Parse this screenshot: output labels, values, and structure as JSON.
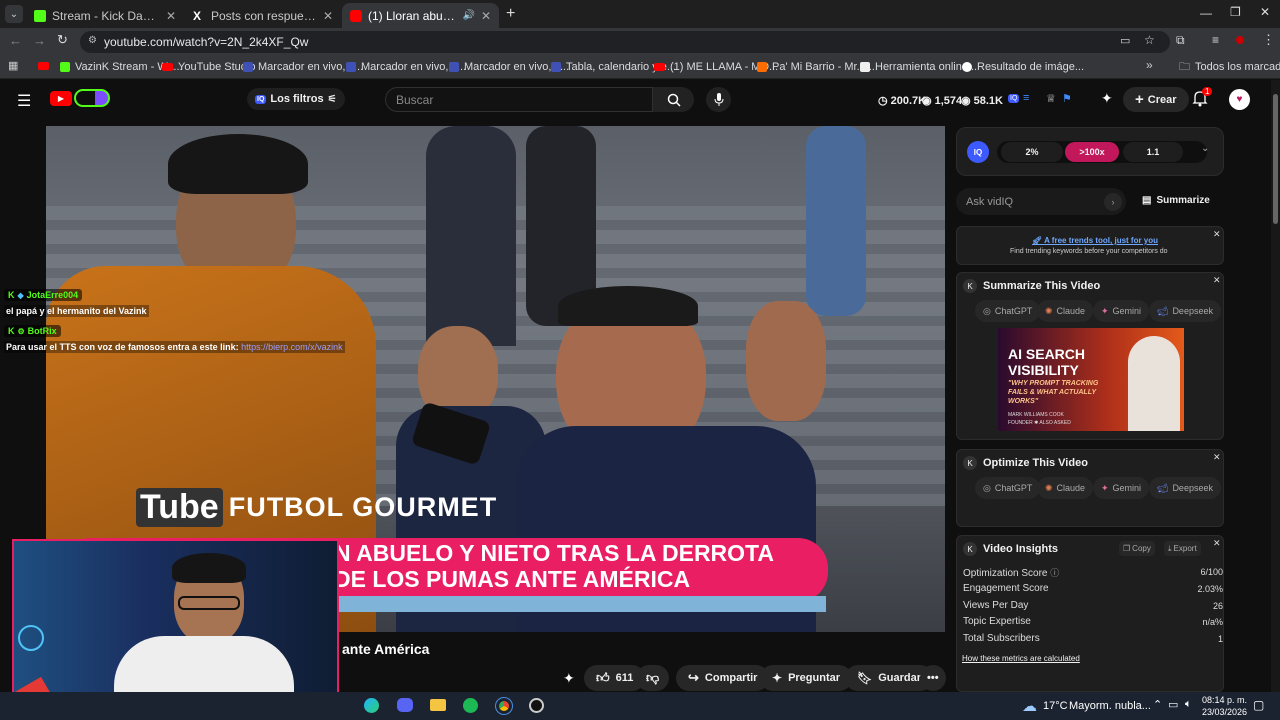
{
  "browser": {
    "tabs": [
      {
        "title": "Stream - Kick Dashboard"
      },
      {
        "title": "Posts con respuestas de VazinK"
      },
      {
        "title": "(1) Lloran abuelo y nieto tras"
      }
    ],
    "url": "youtube.com/watch?v=2N_2k4XF_Qw",
    "bookmarks": [
      "VazinK Stream - Wa...",
      "YouTube Studio",
      "Marcador en vivo, c...",
      "Marcador en vivo, c...",
      "Marcador en vivo, c...",
      "Tabla, calendario y e...",
      "(1) ME LLAMA - MO...",
      "Pa' Mi Barrio - Mr. L...",
      "Herramienta online...",
      "Resultado de imáge..."
    ],
    "all_bookmarks": "Todos los marcadores"
  },
  "youtube": {
    "filters_label": "Los filtros",
    "search_placeholder": "Buscar",
    "stats": {
      "views": "200.7K",
      "watching": "1,574",
      "subs": "58.1K"
    },
    "create_label": "Crear",
    "notif_count": "1",
    "video_title": "ante América",
    "likes": "611",
    "share_label": "Compartir",
    "ask_label": "Preguntar",
    "save_label": "Guardar"
  },
  "video_overlay": {
    "brand": "FUTBOL GOURMET",
    "brand_tube": "Tube",
    "headline1": "N ABUELO Y NIETO TRAS LA DERROTA",
    "headline2": "DE LOS PUMAS ANTE AMÉRICA",
    "chat": [
      {
        "user": "JotaErre004",
        "msg": "el papá y el hermanito del Vazink"
      },
      {
        "user": "BotRix",
        "msg": "Para usar el TTS con voz de famosos entra a este link:",
        "link": "https://bierp.com/x/vazink"
      }
    ]
  },
  "vidiq": {
    "logo": "IQ",
    "pill1": "2%",
    "pill2": ">100x",
    "pill3": "1.1",
    "ask_placeholder": "Ask vidIQ",
    "summarize_label": "Summarize",
    "promo_link": "A free trends tool, just for you",
    "promo_text": "Find trending keywords before your competitors do",
    "summarize_title": "Summarize This Video",
    "optimize_title": "Optimize This Video",
    "ai_buttons": [
      "ChatGPT",
      "Claude",
      "Gemini",
      "Deepseek"
    ],
    "ad": {
      "line1": "AI SEARCH",
      "line2": "VISIBILITY",
      "line3": "\"WHY PROMPT TRACKING",
      "line4": "FAILS & WHAT ACTUALLY",
      "line5": "WORKS\"",
      "author": "MARK WILLIAMS COOK",
      "role": "FOUNDER ✱ ALSO ASKED"
    },
    "insights_title": "Video Insights",
    "copy_label": "Copy",
    "export_label": "Export",
    "metrics": [
      {
        "label": "Optimization Score",
        "value": "6/100"
      },
      {
        "label": "Engagement Score",
        "value": "2.03%"
      },
      {
        "label": "Views Per Day",
        "value": "26"
      },
      {
        "label": "Topic Expertise",
        "value": "n/a%"
      },
      {
        "label": "Total Subscribers",
        "value": "1"
      }
    ],
    "metrics_link": "How these metrics are calculated"
  },
  "taskbar": {
    "temp": "17°C",
    "weather": "Mayorm. nubla...",
    "time": "08:14 p. m.",
    "date": "23/03/2026"
  },
  "colors": {
    "kick": "#53fc18",
    "yt_red": "#ff0000",
    "pink": "#e91e63",
    "vidiq_blue": "#3d5afe",
    "pill_pink": "#c2185b"
  }
}
